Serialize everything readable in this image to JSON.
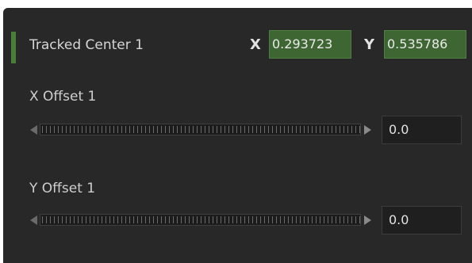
{
  "tracked_center": {
    "label": "Tracked Center 1",
    "x_label": "X",
    "x_value": "0.293723",
    "y_label": "Y",
    "y_value": "0.535786",
    "marker_color": "#4a7c3a"
  },
  "params": [
    {
      "label": "X Offset 1",
      "value": "0.0"
    },
    {
      "label": "Y Offset 1",
      "value": "0.0"
    }
  ],
  "icons": {
    "decrement": "triangle-left",
    "increment": "triangle-right"
  },
  "colors": {
    "panel_bg": "#282828",
    "field_green": "#3e6632",
    "field_dark": "#1f1f1f"
  }
}
